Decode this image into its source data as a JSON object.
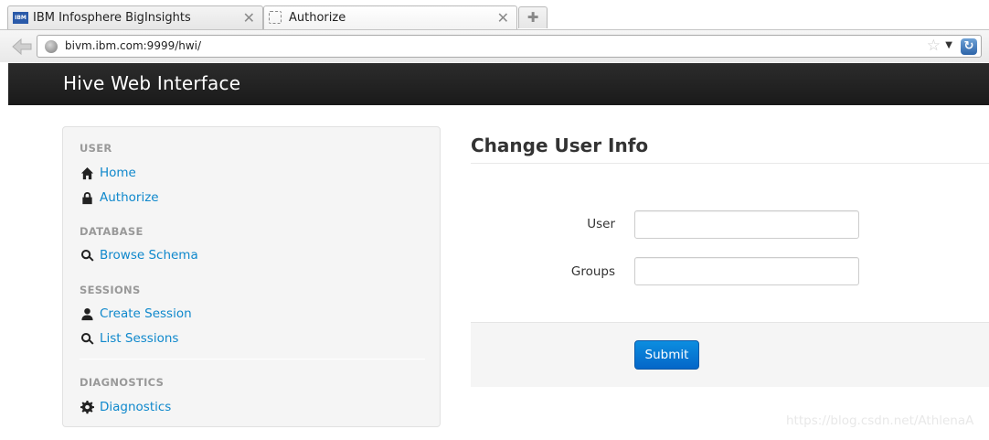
{
  "browser": {
    "tabs": [
      {
        "title": "IBM Infosphere BigInsights",
        "favicon": "IBM",
        "close": "✕"
      },
      {
        "title": "Authorize",
        "close": "✕"
      }
    ],
    "new_tab": "✚",
    "url": "bivm.ibm.com:9999/hwi/",
    "star": "☆",
    "dropdown": "▼",
    "reload": "↻"
  },
  "app": {
    "brand": "Hive Web Interface"
  },
  "sidebar": {
    "sections": [
      {
        "header": "USER",
        "items": [
          {
            "label": "Home",
            "icon": "home-icon"
          },
          {
            "label": "Authorize",
            "icon": "lock-icon"
          }
        ]
      },
      {
        "header": "DATABASE",
        "items": [
          {
            "label": "Browse Schema",
            "icon": "search-icon"
          }
        ]
      },
      {
        "header": "SESSIONS",
        "items": [
          {
            "label": "Create Session",
            "icon": "user-icon"
          },
          {
            "label": "List Sessions",
            "icon": "search-icon"
          }
        ]
      },
      {
        "header": "DIAGNOSTICS",
        "items": [
          {
            "label": "Diagnostics",
            "icon": "gear-icon"
          }
        ]
      }
    ]
  },
  "main": {
    "title": "Change User Info",
    "form": {
      "user_label": "User",
      "user_value": "",
      "groups_label": "Groups",
      "groups_value": "",
      "submit_label": "Submit"
    }
  },
  "watermark": "https://blog.csdn.net/AthlenaA",
  "colors": {
    "link": "#0f88cc",
    "header_bg": "#1f1f1f",
    "primary_button": "#0a7ad6"
  }
}
